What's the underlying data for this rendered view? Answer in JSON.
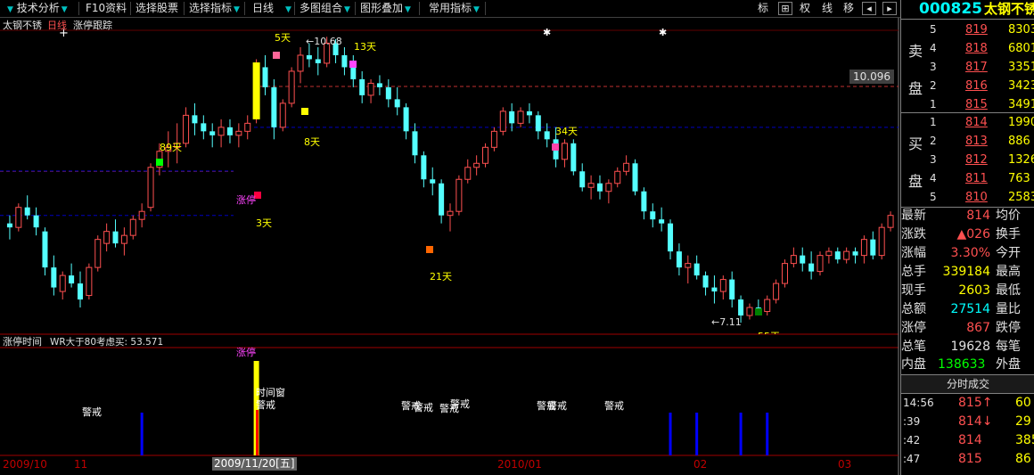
{
  "toolbar": {
    "items": [
      "技术分析",
      "F10资料",
      "选择股票",
      "选择指标",
      "日线",
      "多图组合",
      "图形叠加",
      "常用指标"
    ],
    "right_buttons": [
      "标",
      "⊞",
      "权",
      "线",
      "移"
    ]
  },
  "chart_header": {
    "name": "太钢不锈",
    "period": "日线",
    "indicator": "涨停跟踪"
  },
  "price_tag": "10.096",
  "sub_header": {
    "name": "涨停时间",
    "formula": "WR大于80考虑买: 53.571"
  },
  "annotations": {
    "d5": "5天",
    "d13": "13天",
    "d8": "8天",
    "d34": "34天",
    "d89": "89天",
    "d3": "3天",
    "d21": "21天",
    "d55": "55天",
    "high": "10.68",
    "low": "7.11",
    "limit_up": "涨停",
    "limit_up_sub": "涨停",
    "time_window": "时间窗",
    "warn": "警戒",
    "star": "✱"
  },
  "xaxis": {
    "labels": [
      "2009/10",
      "11",
      "2009/11/20[五]",
      "2010/01",
      "02",
      "03"
    ]
  },
  "chart_data": {
    "type": "candlestick",
    "title": "太钢不锈 日线",
    "ohlc": [
      [
        8.35,
        8.45,
        8.15,
        8.3
      ],
      [
        8.3,
        8.6,
        8.25,
        8.55
      ],
      [
        8.55,
        8.7,
        8.4,
        8.45
      ],
      [
        8.45,
        8.55,
        8.2,
        8.3
      ],
      [
        8.25,
        8.3,
        7.7,
        7.8
      ],
      [
        7.8,
        7.95,
        7.45,
        7.55
      ],
      [
        7.5,
        7.75,
        7.4,
        7.7
      ],
      [
        7.7,
        7.85,
        7.55,
        7.6
      ],
      [
        7.6,
        7.75,
        7.3,
        7.4
      ],
      [
        7.45,
        7.85,
        7.4,
        7.8
      ],
      [
        7.8,
        8.2,
        7.75,
        8.15
      ],
      [
        8.1,
        8.35,
        8.0,
        8.25
      ],
      [
        8.25,
        8.4,
        8.05,
        8.1
      ],
      [
        8.1,
        8.3,
        7.95,
        8.2
      ],
      [
        8.2,
        8.45,
        8.15,
        8.4
      ],
      [
        8.4,
        8.6,
        8.3,
        8.5
      ],
      [
        8.55,
        9.1,
        8.5,
        9.05
      ],
      [
        9.05,
        9.35,
        8.95,
        9.25
      ],
      [
        9.25,
        9.5,
        9.05,
        9.3
      ],
      [
        9.3,
        9.6,
        9.1,
        9.35
      ],
      [
        9.35,
        9.8,
        9.3,
        9.7
      ],
      [
        9.7,
        9.85,
        9.45,
        9.6
      ],
      [
        9.6,
        9.7,
        9.4,
        9.5
      ],
      [
        9.5,
        9.6,
        9.3,
        9.45
      ],
      [
        9.45,
        9.65,
        9.3,
        9.55
      ],
      [
        9.55,
        9.65,
        9.35,
        9.45
      ],
      [
        9.45,
        9.6,
        9.3,
        9.5
      ],
      [
        9.5,
        9.7,
        9.4,
        9.6
      ],
      [
        9.65,
        10.4,
        9.6,
        10.36
      ],
      [
        10.3,
        10.45,
        9.95,
        10.05
      ],
      [
        10.05,
        10.15,
        9.4,
        9.55
      ],
      [
        9.55,
        9.9,
        9.5,
        9.85
      ],
      [
        9.85,
        10.3,
        9.8,
        10.25
      ],
      [
        10.25,
        10.55,
        10.1,
        10.45
      ],
      [
        10.45,
        10.6,
        10.3,
        10.4
      ],
      [
        10.4,
        10.55,
        10.2,
        10.35
      ],
      [
        10.35,
        10.68,
        10.3,
        10.6
      ],
      [
        10.6,
        10.65,
        10.35,
        10.45
      ],
      [
        10.45,
        10.55,
        10.2,
        10.3
      ],
      [
        10.3,
        10.45,
        10.05,
        10.15
      ],
      [
        10.15,
        10.25,
        9.85,
        9.95
      ],
      [
        9.95,
        10.15,
        9.85,
        10.1
      ],
      [
        10.1,
        10.2,
        9.95,
        10.05
      ],
      [
        10.05,
        10.15,
        9.8,
        9.9
      ],
      [
        9.9,
        10.05,
        9.7,
        9.8
      ],
      [
        9.8,
        9.85,
        9.4,
        9.5
      ],
      [
        9.5,
        9.6,
        9.1,
        9.2
      ],
      [
        9.2,
        9.25,
        8.8,
        8.9
      ],
      [
        8.9,
        9.05,
        8.7,
        8.85
      ],
      [
        8.85,
        8.9,
        8.35,
        8.45
      ],
      [
        8.45,
        8.6,
        8.25,
        8.5
      ],
      [
        8.5,
        8.95,
        8.45,
        8.9
      ],
      [
        8.9,
        9.15,
        8.85,
        9.05
      ],
      [
        9.05,
        9.2,
        8.95,
        9.1
      ],
      [
        9.1,
        9.35,
        9.05,
        9.3
      ],
      [
        9.3,
        9.55,
        9.25,
        9.5
      ],
      [
        9.5,
        9.8,
        9.45,
        9.75
      ],
      [
        9.75,
        9.85,
        9.5,
        9.6
      ],
      [
        9.6,
        9.8,
        9.55,
        9.75
      ],
      [
        9.75,
        9.85,
        9.6,
        9.7
      ],
      [
        9.7,
        9.75,
        9.4,
        9.5
      ],
      [
        9.5,
        9.6,
        9.3,
        9.4
      ],
      [
        9.4,
        9.55,
        9.05,
        9.15
      ],
      [
        9.15,
        9.4,
        9.05,
        9.35
      ],
      [
        9.35,
        9.4,
        8.95,
        9.0
      ],
      [
        9.0,
        9.1,
        8.75,
        8.8
      ],
      [
        8.8,
        8.95,
        8.65,
        8.85
      ],
      [
        8.85,
        8.95,
        8.65,
        8.75
      ],
      [
        8.75,
        8.9,
        8.6,
        8.85
      ],
      [
        8.85,
        9.05,
        8.8,
        9.0
      ],
      [
        9.0,
        9.2,
        8.95,
        9.1
      ],
      [
        9.1,
        9.15,
        8.7,
        8.75
      ],
      [
        8.75,
        8.8,
        8.4,
        8.5
      ],
      [
        8.5,
        8.6,
        8.3,
        8.4
      ],
      [
        8.4,
        8.55,
        8.25,
        8.35
      ],
      [
        8.35,
        8.4,
        7.9,
        8.0
      ],
      [
        8.0,
        8.1,
        7.7,
        7.8
      ],
      [
        7.8,
        7.95,
        7.6,
        7.85
      ],
      [
        7.85,
        7.95,
        7.65,
        7.7
      ],
      [
        7.7,
        7.75,
        7.45,
        7.55
      ],
      [
        7.55,
        7.7,
        7.35,
        7.5
      ],
      [
        7.5,
        7.7,
        7.4,
        7.65
      ],
      [
        7.65,
        7.75,
        7.3,
        7.4
      ],
      [
        7.4,
        7.45,
        7.11,
        7.2
      ],
      [
        7.2,
        7.35,
        7.15,
        7.3
      ],
      [
        7.3,
        7.4,
        7.2,
        7.25
      ],
      [
        7.25,
        7.45,
        7.2,
        7.4
      ],
      [
        7.4,
        7.65,
        7.35,
        7.6
      ],
      [
        7.6,
        7.9,
        7.55,
        7.85
      ],
      [
        7.85,
        8.05,
        7.8,
        7.95
      ],
      [
        7.95,
        8.05,
        7.75,
        7.85
      ],
      [
        7.85,
        8.0,
        7.65,
        7.75
      ],
      [
        7.75,
        8.0,
        7.7,
        7.95
      ],
      [
        7.95,
        8.05,
        7.85,
        8.0
      ],
      [
        8.0,
        8.05,
        7.85,
        7.9
      ],
      [
        7.9,
        8.05,
        7.85,
        8.0
      ],
      [
        8.0,
        8.05,
        7.85,
        7.95
      ],
      [
        7.95,
        8.2,
        7.85,
        8.15
      ],
      [
        8.15,
        8.25,
        7.9,
        7.95
      ],
      [
        7.95,
        8.35,
        7.9,
        8.3
      ],
      [
        8.3,
        8.5,
        8.25,
        8.45
      ]
    ],
    "high_label": 10.68,
    "low_label": 7.11,
    "last_price": 10.096,
    "ref_lines": [
      10.06,
      9.55,
      9.0,
      8.45
    ],
    "limit_up_index": 28,
    "warning_indices": [
      15,
      75,
      78,
      83,
      86,
      103,
      105,
      114
    ]
  },
  "right_panel": {
    "code": "000825",
    "name": "太钢不锈",
    "sell_label": [
      "卖",
      "盘"
    ],
    "buy_label": [
      "买",
      "盘"
    ],
    "asks": [
      {
        "level": "5",
        "price": "819",
        "vol": "8303"
      },
      {
        "level": "4",
        "price": "818",
        "vol": "6801"
      },
      {
        "level": "3",
        "price": "817",
        "vol": "3351"
      },
      {
        "level": "2",
        "price": "816",
        "vol": "3423"
      },
      {
        "level": "1",
        "price": "815",
        "vol": "3491"
      }
    ],
    "bids": [
      {
        "level": "1",
        "price": "814",
        "vol": "1990"
      },
      {
        "level": "2",
        "price": "813",
        "vol": "886"
      },
      {
        "level": "3",
        "price": "812",
        "vol": "1326"
      },
      {
        "level": "4",
        "price": "811",
        "vol": "763"
      },
      {
        "level": "5",
        "price": "810",
        "vol": "2583"
      }
    ],
    "stats": [
      {
        "k1": "最新",
        "v1": "814",
        "k2": "均价",
        "color": "#ff5050"
      },
      {
        "k1": "涨跌",
        "v1": "▲026",
        "k2": "换手",
        "color": "#ff5050"
      },
      {
        "k1": "涨幅",
        "v1": "3.30%",
        "k2": "今开",
        "color": "#ff5050"
      },
      {
        "k1": "总手",
        "v1": "339184",
        "k2": "最高",
        "color": "#ffff00"
      },
      {
        "k1": "现手",
        "v1": "2603",
        "k2": "最低",
        "color": "#ffff00"
      },
      {
        "k1": "总额",
        "v1": "27514",
        "k2": "量比",
        "color": "#00ffff"
      },
      {
        "k1": "涨停",
        "v1": "867",
        "k2": "跌停",
        "color": "#ff5050"
      },
      {
        "k1": "总笔",
        "v1": "19628",
        "k2": "每笔",
        "color": "#e0e0e0"
      }
    ],
    "inner_label": "内盘",
    "inner_val": "138633",
    "outer_label": "外盘",
    "tick_title": "分时成交",
    "ticks": [
      {
        "t": "14:56",
        "p": "815↑",
        "v": "60"
      },
      {
        "t": ":39",
        "p": "814↓",
        "v": "29"
      },
      {
        "t": ":42",
        "p": "814",
        "v": "385"
      },
      {
        "t": ":47",
        "p": "815",
        "v": "86"
      }
    ]
  }
}
